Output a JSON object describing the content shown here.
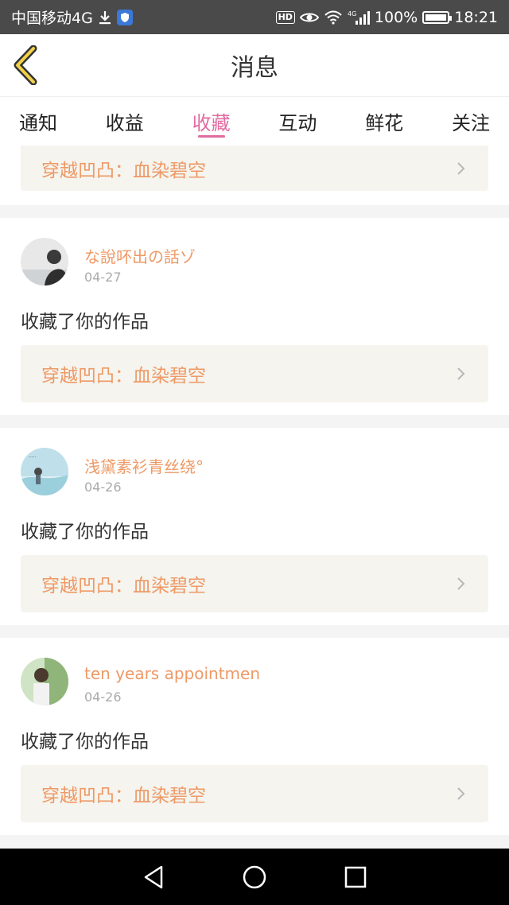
{
  "status_bar": {
    "carrier": "中国移动4G",
    "hd": "HD",
    "network": "4G",
    "battery": "100%",
    "time": "18:21"
  },
  "header": {
    "title": "消息",
    "back_icon": "chevron-left-icon"
  },
  "tabs": [
    {
      "label": "通知",
      "active": false
    },
    {
      "label": "收益",
      "active": false
    },
    {
      "label": "收藏",
      "active": true
    },
    {
      "label": "互动",
      "active": false
    },
    {
      "label": "鲜花",
      "active": false
    },
    {
      "label": "关注",
      "active": false
    }
  ],
  "feed": {
    "partial_item": {
      "work_title": "穿越凹凸：血染碧空"
    },
    "items": [
      {
        "user": "な說吥出の話ゾ",
        "time": "04-27",
        "action": "收藏了你的作品",
        "work_title": "穿越凹凸：血染碧空"
      },
      {
        "user": "浅黛素衫青丝绕°",
        "time": "04-26",
        "action": "收藏了你的作品",
        "work_title": "穿越凹凸：血染碧空"
      },
      {
        "user": "ten years appointmen",
        "time": "04-26",
        "action": "收藏了你的作品",
        "work_title": "穿越凹凸：血染碧空"
      }
    ]
  },
  "colors": {
    "accent_pink": "#e06ba0",
    "accent_orange": "#ee9966",
    "status_bar": "#4a4a4a"
  },
  "nav_bar": {
    "back": "triangle-back-icon",
    "home": "circle-home-icon",
    "recents": "square-recents-icon"
  }
}
